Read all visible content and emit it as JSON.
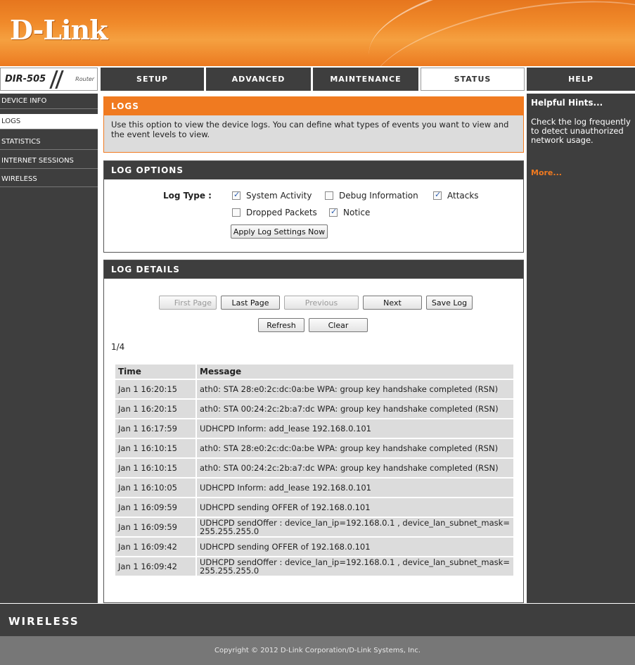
{
  "brand": {
    "logo": "D-Link",
    "model": "DIR-505",
    "model_type": "Router",
    "footer_word": "WIRELESS"
  },
  "nav": {
    "tabs": [
      {
        "label": "SETUP"
      },
      {
        "label": "ADVANCED"
      },
      {
        "label": "MAINTENANCE"
      },
      {
        "label": "STATUS",
        "active": true
      },
      {
        "label": "HELP"
      }
    ]
  },
  "sidebar": {
    "items": [
      {
        "label": "DEVICE INFO"
      },
      {
        "label": "LOGS",
        "active": true
      },
      {
        "label": "STATISTICS"
      },
      {
        "label": "INTERNET SESSIONS"
      },
      {
        "label": "WIRELESS"
      }
    ]
  },
  "logs": {
    "title": "LOGS",
    "description": "Use this option to view the device logs. You can define what types of events you want to view and the event levels to view."
  },
  "log_options": {
    "title": "LOG OPTIONS",
    "log_type_label": "Log Type :",
    "checkboxes": [
      {
        "label": "System Activity",
        "checked": true
      },
      {
        "label": "Debug Information",
        "checked": false
      },
      {
        "label": "Attacks",
        "checked": true
      },
      {
        "label": "Dropped Packets",
        "checked": false
      },
      {
        "label": "Notice",
        "checked": true
      }
    ],
    "apply_label": "Apply Log Settings Now"
  },
  "log_details": {
    "title": "LOG DETAILS",
    "buttons": {
      "first": "First Page",
      "last": "Last Page",
      "previous": "Previous",
      "next": "Next",
      "save": "Save Log",
      "refresh": "Refresh",
      "clear": "Clear"
    },
    "page_indicator": "1/4",
    "columns": [
      "Time",
      "Message"
    ],
    "rows": [
      {
        "time": "Jan 1 16:20:15",
        "message": "ath0: STA 28:e0:2c:dc:0a:be WPA: group key handshake completed (RSN)"
      },
      {
        "time": "Jan 1 16:20:15",
        "message": "ath0: STA 00:24:2c:2b:a7:dc WPA: group key handshake completed (RSN)"
      },
      {
        "time": "Jan 1 16:17:59",
        "message": "UDHCPD Inform: add_lease 192.168.0.101"
      },
      {
        "time": "Jan 1 16:10:15",
        "message": "ath0: STA 28:e0:2c:dc:0a:be WPA: group key handshake completed (RSN)"
      },
      {
        "time": "Jan 1 16:10:15",
        "message": "ath0: STA 00:24:2c:2b:a7:dc WPA: group key handshake completed (RSN)"
      },
      {
        "time": "Jan 1 16:10:05",
        "message": "UDHCPD Inform: add_lease 192.168.0.101"
      },
      {
        "time": "Jan 1 16:09:59",
        "message": "UDHCPD sending OFFER of 192.168.0.101"
      },
      {
        "time": "Jan 1 16:09:59",
        "message": "UDHCPD sendOffer : device_lan_ip=192.168.0.1 , device_lan_subnet_mask=255.255.255.0"
      },
      {
        "time": "Jan 1 16:09:42",
        "message": "UDHCPD sending OFFER of 192.168.0.101"
      },
      {
        "time": "Jan 1 16:09:42",
        "message": "UDHCPD sendOffer : device_lan_ip=192.168.0.1 , device_lan_subnet_mask=255.255.255.0"
      }
    ]
  },
  "help": {
    "title": "Helpful Hints...",
    "text": "Check the log frequently to detect unauthorized network usage.",
    "more": "More..."
  },
  "footer": {
    "copyright": "Copyright © 2012 D-Link Corporation/D-Link Systems, Inc."
  },
  "colors": {
    "accent": "#f07a20",
    "dark": "#3e3e3e",
    "footer_gray": "#777777"
  }
}
